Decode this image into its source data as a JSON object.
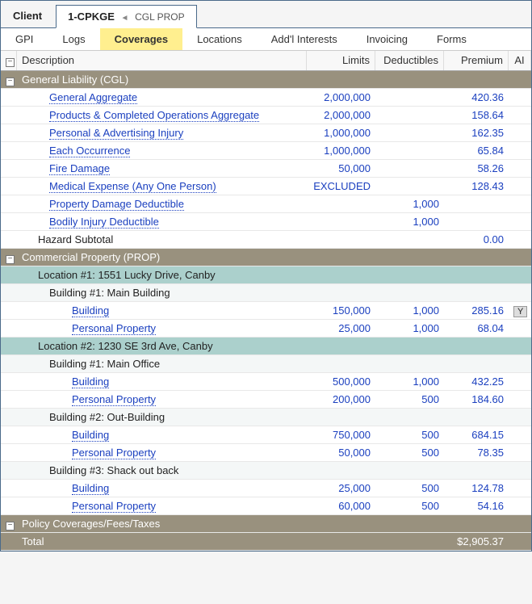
{
  "top_tabs": {
    "client": "Client",
    "active_label": "1-CPKGE",
    "active_sub": "CGL  PROP"
  },
  "sub_tabs": [
    "GPI",
    "Logs",
    "Coverages",
    "Locations",
    "Add'l Interests",
    "Invoicing",
    "Forms"
  ],
  "active_sub_tab": "Coverages",
  "columns": {
    "desc": "Description",
    "limits": "Limits",
    "deduct": "Deductibles",
    "premium": "Premium",
    "ai": "AI"
  },
  "sections": {
    "cgl": {
      "title": "General Liability (CGL)",
      "rows": [
        {
          "desc": "General Aggregate",
          "limits": "2,000,000",
          "deduct": "",
          "premium": "420.36"
        },
        {
          "desc": "Products & Completed Operations Aggregate",
          "limits": "2,000,000",
          "deduct": "",
          "premium": "158.64"
        },
        {
          "desc": "Personal & Advertising Injury",
          "limits": "1,000,000",
          "deduct": "",
          "premium": "162.35"
        },
        {
          "desc": "Each Occurrence",
          "limits": "1,000,000",
          "deduct": "",
          "premium": "65.84"
        },
        {
          "desc": "Fire Damage",
          "limits": "50,000",
          "deduct": "",
          "premium": "58.26"
        },
        {
          "desc": "Medical Expense (Any One Person)",
          "limits": "EXCLUDED",
          "deduct": "",
          "premium": "128.43"
        },
        {
          "desc": "Property Damage Deductible",
          "limits": "",
          "deduct": "1,000",
          "premium": ""
        },
        {
          "desc": "Bodily Injury Deductible",
          "limits": "",
          "deduct": "1,000",
          "premium": ""
        }
      ],
      "subtotal_label": "Hazard Subtotal",
      "subtotal_value": "0.00"
    },
    "prop": {
      "title": "Commercial Property (PROP)",
      "locations": [
        {
          "title": "Location #1: 1551 Lucky Drive, Canby",
          "buildings": [
            {
              "title": "Building #1: Main Building",
              "rows": [
                {
                  "desc": "Building",
                  "limits": "150,000",
                  "deduct": "1,000",
                  "premium": "285.16",
                  "ai": "Y"
                },
                {
                  "desc": "Personal Property",
                  "limits": "25,000",
                  "deduct": "1,000",
                  "premium": "68.04"
                }
              ]
            }
          ]
        },
        {
          "title": "Location #2: 1230 SE 3rd Ave, Canby",
          "buildings": [
            {
              "title": "Building #1: Main Office",
              "rows": [
                {
                  "desc": "Building",
                  "limits": "500,000",
                  "deduct": "1,000",
                  "premium": "432.25"
                },
                {
                  "desc": "Personal Property",
                  "limits": "200,000",
                  "deduct": "500",
                  "premium": "184.60"
                }
              ]
            },
            {
              "title": "Building #2: Out-Building",
              "rows": [
                {
                  "desc": "Building",
                  "limits": "750,000",
                  "deduct": "500",
                  "premium": "684.15"
                },
                {
                  "desc": "Personal Property",
                  "limits": "50,000",
                  "deduct": "500",
                  "premium": "78.35"
                }
              ]
            },
            {
              "title": "Building #3: Shack out back",
              "rows": [
                {
                  "desc": "Building",
                  "limits": "25,000",
                  "deduct": "500",
                  "premium": "124.78"
                },
                {
                  "desc": "Personal Property",
                  "limits": "60,000",
                  "deduct": "500",
                  "premium": "54.16"
                }
              ]
            }
          ]
        }
      ]
    },
    "policy": {
      "title": "Policy Coverages/Fees/Taxes"
    }
  },
  "total": {
    "label": "Total",
    "value": "$2,905.37"
  }
}
